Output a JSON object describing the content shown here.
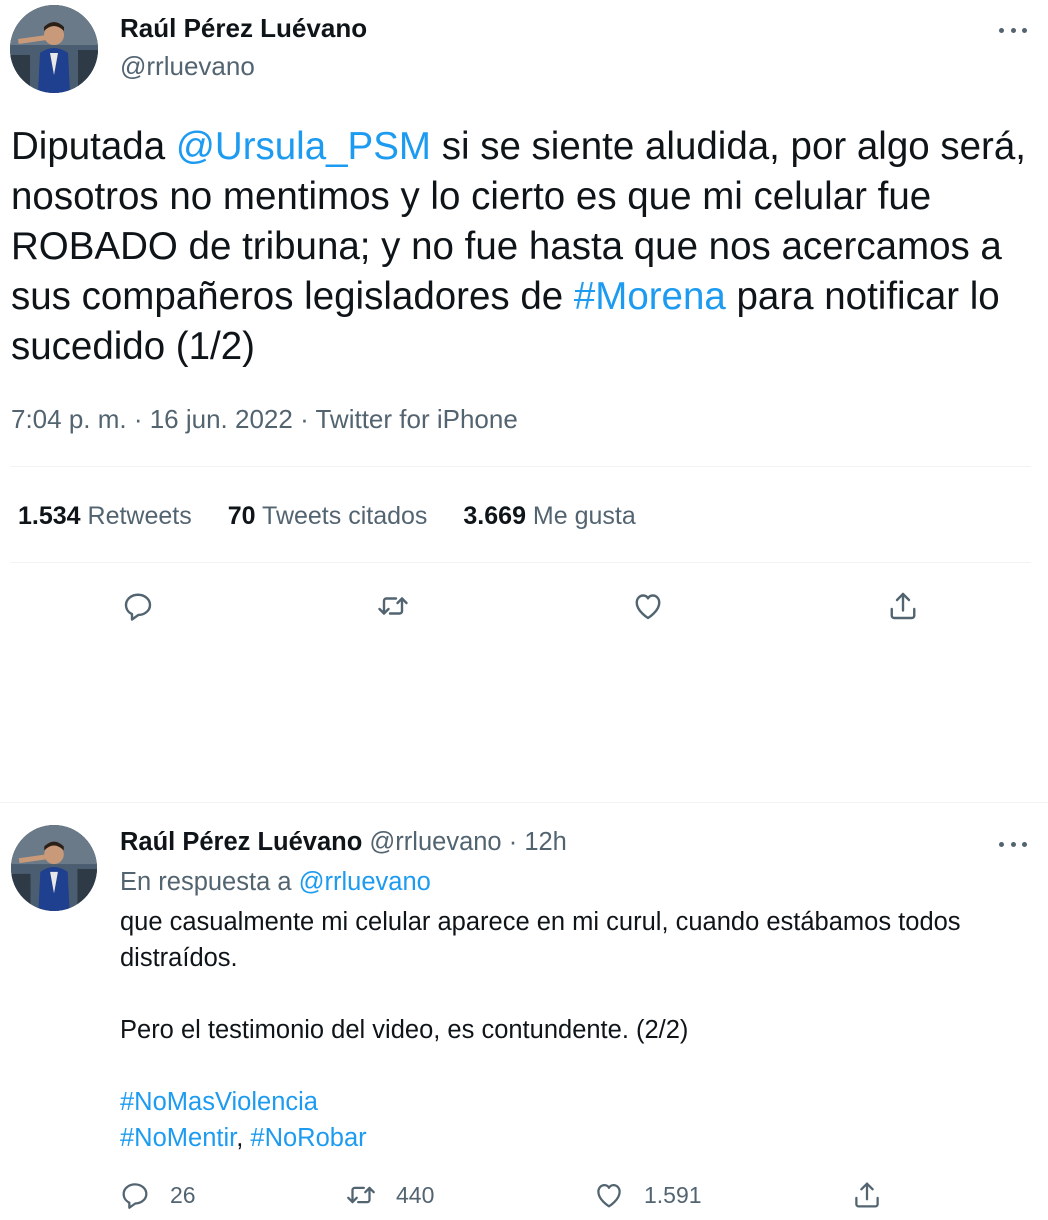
{
  "tweet": {
    "author_name": "Raúl Pérez Luévano",
    "author_handle": "@rrluevano",
    "text_parts": {
      "p1": "Diputada ",
      "mention": "@Ursula_PSM",
      "p2": " si se siente aludida, por algo será, nosotros no mentimos y lo cierto es que mi celular fue ROBADO de tribuna; y no fue hasta que nos acercamos a sus compañeros legisladores de ",
      "hashtag": "#Morena",
      "p3": " para notificar lo sucedido (1/2)"
    },
    "meta": "7:04 p. m. · 16 jun. 2022 · Twitter for iPhone",
    "stats": {
      "retweets_count": "1.534",
      "retweets_label": "Retweets",
      "quotes_count": "70",
      "quotes_label": "Tweets citados",
      "likes_count": "3.669",
      "likes_label": "Me gusta"
    },
    "actions": [
      "reply-icon",
      "retweet-icon",
      "like-icon",
      "share-icon"
    ]
  },
  "reply": {
    "author_name": "Raúl Pérez Luévano",
    "author_handle": "@rrluevano",
    "separator": "·",
    "time": "12h",
    "replying_to_label": "En respuesta a ",
    "replying_to_handle": "@rrluevano",
    "text_line1": "que casualmente mi celular aparece en mi curul, cuando estábamos todos distraídos.",
    "text_line2": "Pero el testimonio del video, es contundente. (2/2)",
    "hashtag1": "#NoMasViolencia",
    "hashtag2": "#NoMentir",
    "hashtag_sep": ", ",
    "hashtag3": "#NoRobar",
    "counts": {
      "replies": "26",
      "retweets": "440",
      "likes": "1.591"
    }
  },
  "colors": {
    "accent": "#1d9bf0",
    "text": "#0f1419",
    "secondary": "#536471",
    "divider": "#eff3f4"
  }
}
